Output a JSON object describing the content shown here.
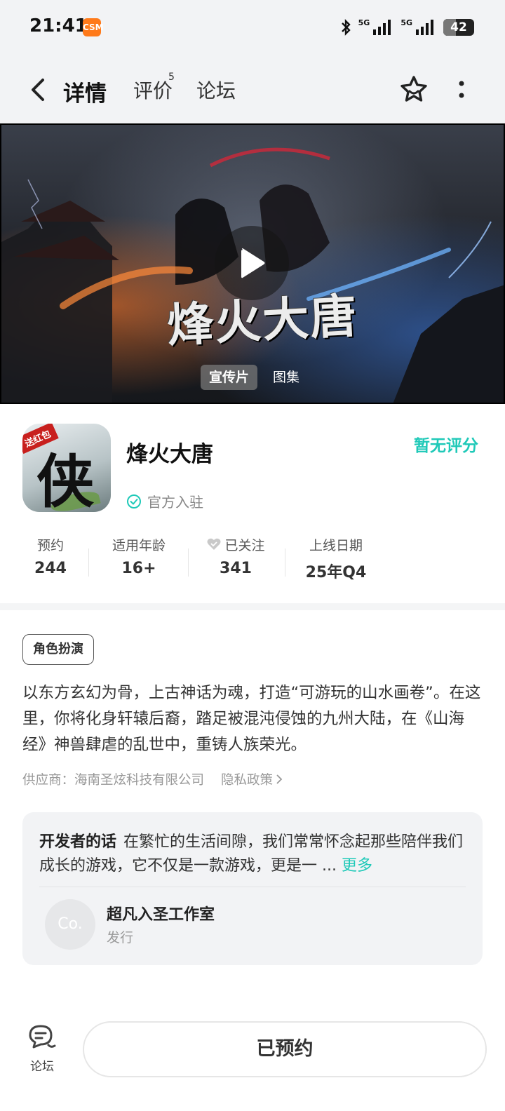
{
  "status_bar": {
    "time": "21:41",
    "app_badge": "CSM",
    "network_1": "5G",
    "network_2": "5G",
    "battery_level": "42",
    "battery_fraction": 0.42
  },
  "nav": {
    "tabs": [
      {
        "label": "详情",
        "active": true
      },
      {
        "label": "评价",
        "badge": "5"
      },
      {
        "label": "论坛"
      }
    ],
    "icons": [
      "back-icon",
      "star-icon",
      "more-icon"
    ]
  },
  "banner": {
    "art_title": "烽火大唐",
    "media_tabs": [
      {
        "label": "宣传片",
        "active": true
      },
      {
        "label": "图集",
        "active": false
      }
    ]
  },
  "app": {
    "icon_badge": "送红包",
    "icon_glyph": "侠",
    "name": "烽火大唐",
    "official_label": "官方入驻",
    "rating_label": "暂无评分"
  },
  "stats": [
    {
      "label": "预约",
      "value": "244"
    },
    {
      "label": "适用年龄",
      "value": "16+"
    },
    {
      "label": "已关注",
      "value": "341"
    },
    {
      "label": "上线日期",
      "value": "25年Q4"
    }
  ],
  "genre_tag": "角色扮演",
  "description": "以东方玄幻为骨，上古神话为魂，打造“可游玩的山水画卷”。在这里，你将化身轩辕后裔，踏足被混沌侵蚀的九州大陆，在《山海经》神兽肆虐的乱世中，重铸人族荣光。",
  "meta": {
    "supplier": "供应商：海南圣炫科技有限公司",
    "privacy_label": "隐私政策"
  },
  "developer": {
    "title": "开发者的话",
    "text": "在繁忙的生活间隙，我们常常怀念起那些陪伴我们成长的游戏，它不仅是一款游戏，更是一 ... ",
    "more_label": "更多",
    "studio_avatar": "Co.",
    "studio_name": "超凡入圣工作室",
    "studio_role": "发行"
  },
  "bottom": {
    "forum_label": "论坛",
    "reserve_label": "已预约"
  },
  "colors": {
    "accent": "#1fc9b8",
    "background": "#f2f3f5"
  }
}
